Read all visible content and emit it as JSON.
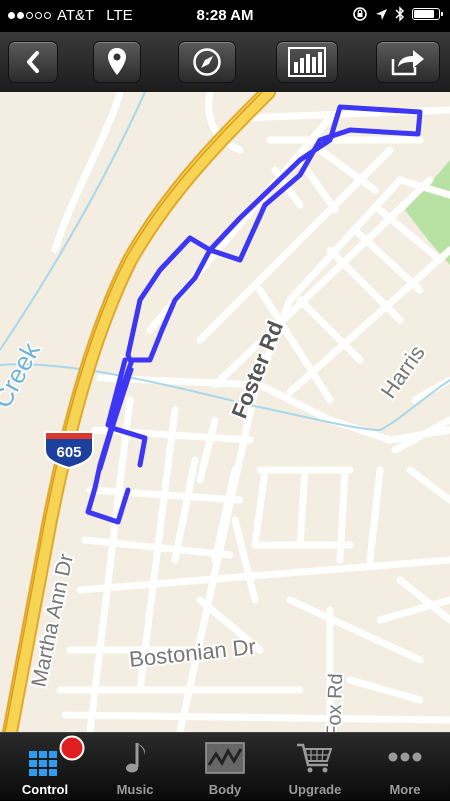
{
  "status_bar": {
    "signal_strength_dots": 2,
    "carrier": "AT&T",
    "network": "LTE",
    "time": "8:28 AM",
    "icons": [
      "rotation-lock-icon",
      "location-arrow-icon",
      "bluetooth-icon",
      "battery-icon"
    ],
    "battery_level": 0.9
  },
  "toolbar": {
    "buttons": [
      {
        "name": "back-button",
        "icon": "chevron-left-icon"
      },
      {
        "name": "location-button",
        "icon": "map-pin-icon"
      },
      {
        "name": "compass-button",
        "icon": "compass-icon"
      },
      {
        "name": "stats-button",
        "icon": "bar-chart-icon"
      },
      {
        "name": "share-button",
        "icon": "share-arrow-icon"
      }
    ]
  },
  "map": {
    "labels": {
      "foster_rd": "Foster Rd",
      "creek": "Creek",
      "harris": "Harris",
      "highway_shield": "605",
      "martha_ann_dr": "Martha Ann Dr",
      "bostonian_dr": "Bostonian Dr",
      "fox_rd": "Fox Rd"
    },
    "route_color": "#3d36f2",
    "freeway_color": "#f5c63b",
    "park_color": "#b8e2a4"
  },
  "tab_bar": {
    "tabs": [
      {
        "label": "Control",
        "icon": "grid-icon",
        "active": true,
        "badge": "recording-dot"
      },
      {
        "label": "Music",
        "icon": "music-note-icon",
        "active": false
      },
      {
        "label": "Body",
        "icon": "heart-rate-chart-icon",
        "active": false
      },
      {
        "label": "Upgrade",
        "icon": "shopping-cart-icon",
        "active": false
      },
      {
        "label": "More",
        "icon": "more-dots-icon",
        "active": false
      }
    ]
  }
}
